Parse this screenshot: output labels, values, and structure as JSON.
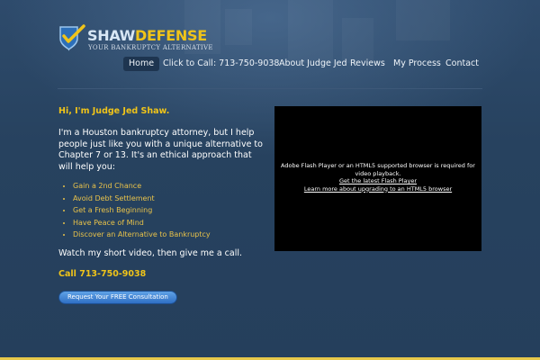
{
  "brand": {
    "name_part1": "SHAW",
    "name_part2": "DEFENSE",
    "tagline": "YOUR BANKRUPTCY ALTERNATIVE"
  },
  "nav": {
    "items": [
      {
        "label": "Home",
        "active": true
      },
      {
        "label": "Click to Call: 713-750-9038"
      },
      {
        "label": "About Judge Jed"
      },
      {
        "label": "Reviews"
      },
      {
        "label": "My Process"
      },
      {
        "label": "Contact"
      }
    ]
  },
  "main": {
    "greeting": "Hi, I'm Judge Jed Shaw.",
    "intro": "I'm a Houston bankruptcy attorney, but I help people just like you with a unique alternative to Chapter 7 or 13.  It's an ethical approach that will help you:",
    "bullets": [
      "Gain a 2nd Chance",
      "Avoid Debt Settlement",
      "Get a Fresh Beginning",
      "Have Peace of Mind",
      "Discover an Alternative to Bankruptcy"
    ],
    "video_note": "Watch my short video, then give me a call.",
    "call": "Call 713-750-9038",
    "cta_label": "Request Your FREE Consultation"
  },
  "video": {
    "message": "Adobe Flash Player or an HTML5 supported browser is required for video playback.",
    "link_flash": "Get the latest Flash Player",
    "link_html5": "Learn more about upgrading to an HTML5 browser"
  },
  "colors": {
    "background": "#264160",
    "accent": "#f0c419",
    "bullet_text": "#e8c24a",
    "button": "#3d84d6",
    "footer_bar": "#e6c84a"
  },
  "icons": {
    "logo": "shield-check-icon"
  }
}
